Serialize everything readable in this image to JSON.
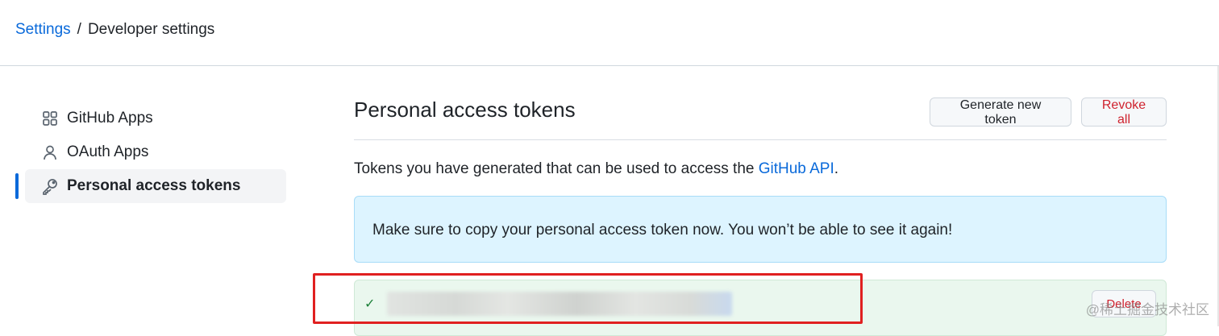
{
  "breadcrumb": {
    "root": "Settings",
    "separator": "/",
    "current": "Developer settings"
  },
  "sidebar": {
    "items": [
      {
        "label": "GitHub Apps",
        "icon": "apps-grid-icon",
        "active": false
      },
      {
        "label": "OAuth Apps",
        "icon": "person-icon",
        "active": false
      },
      {
        "label": "Personal access tokens",
        "icon": "key-icon",
        "active": true
      }
    ]
  },
  "main": {
    "title": "Personal access tokens",
    "generate_label": "Generate new token",
    "revoke_label": "Revoke all",
    "description_prefix": "Tokens you have generated that can be used to access the ",
    "description_link": "GitHub API",
    "description_suffix": ".",
    "flash": "Make sure to copy your personal access token now. You won’t be able to see it again!",
    "token": {
      "check_glyph": "✓",
      "delete_label": "Delete"
    }
  },
  "watermark": "@稀土掘金技术社区",
  "colors": {
    "link": "#0969da",
    "danger": "#cf222e",
    "flash_bg": "#ddf4ff",
    "success_bg": "#eaf7ee",
    "annotation": "#e02020"
  }
}
